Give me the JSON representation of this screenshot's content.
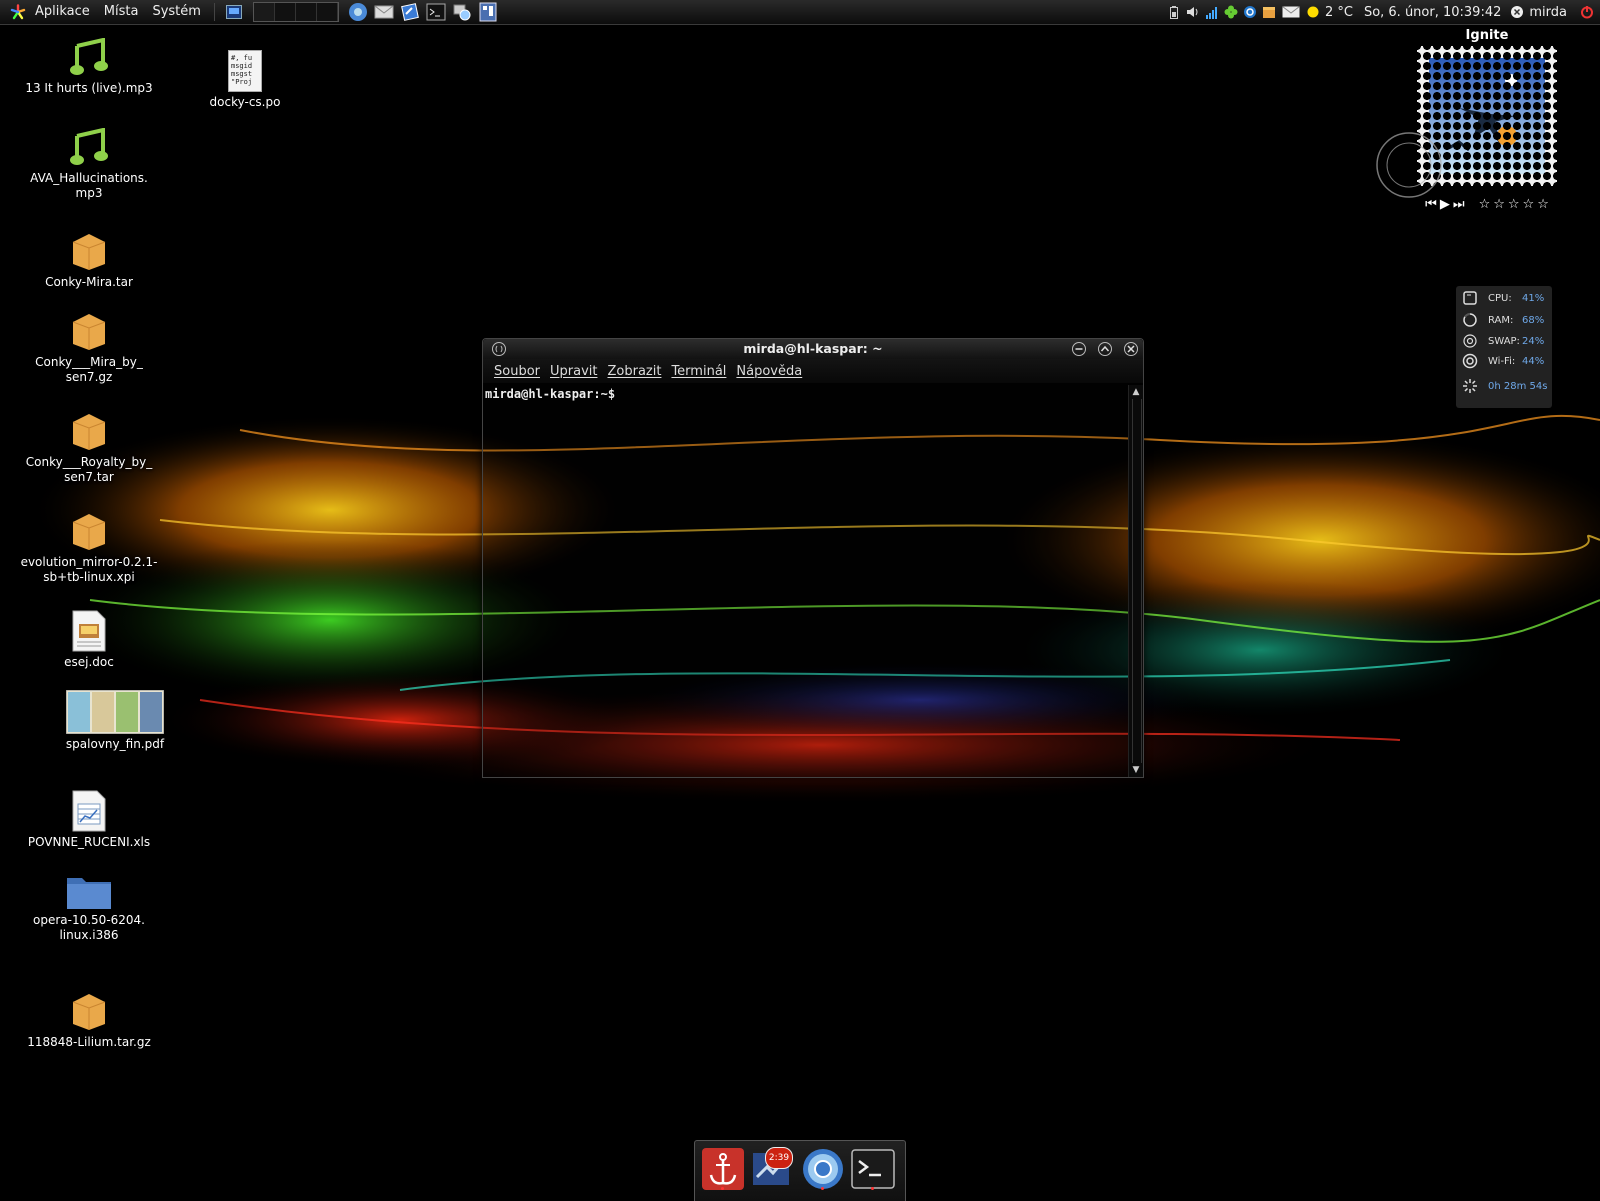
{
  "top_panel": {
    "menus": [
      "Aplikace",
      "Místa",
      "Systém"
    ],
    "weather": "2 °C",
    "clock": "So, 6. únor, 10:39:42",
    "user": "mirda",
    "launcher_icons": [
      "chromium-icon",
      "mail-icon",
      "feed-icon",
      "terminal-icon",
      "network-icon",
      "screenshot-icon"
    ],
    "tray_icons": [
      "battery-icon",
      "volume-icon",
      "signal-icon",
      "clover-icon",
      "sync-icon",
      "package-icon",
      "mail-icon",
      "sun-icon",
      "user-x-icon",
      "power-icon"
    ]
  },
  "desktop": {
    "icons": [
      {
        "label": "13 It hurts (live).mp3",
        "type": "audio"
      },
      {
        "label": "AVA_Hallucinations.\nmp3",
        "type": "audio"
      },
      {
        "label": "Conky-Mira.tar",
        "type": "archive"
      },
      {
        "label": "Conky___Mira_by_\nsen7.gz",
        "type": "archive"
      },
      {
        "label": "Conky___Royalty_by_\nsen7.tar",
        "type": "archive"
      },
      {
        "label": "evolution_mirror-0.2.1-\nsb+tb-linux.xpi",
        "type": "archive"
      },
      {
        "label": "esej.doc",
        "type": "document"
      },
      {
        "label": "spalovny_fin.pdf",
        "type": "pdf"
      },
      {
        "label": "POVNNE_RUCENI.xls",
        "type": "spreadsheet"
      },
      {
        "label": "opera-10.50-6204.\nlinux.i386",
        "type": "folder"
      },
      {
        "label": "118848-Lilium.tar.gz",
        "type": "archive"
      },
      {
        "label": "docky-cs.po",
        "type": "text"
      }
    ],
    "po_preview": [
      "#, fu",
      "msgid",
      "msgst",
      "\"Proj"
    ]
  },
  "terminal": {
    "title": "mirda@hl-kaspar: ~",
    "menu": [
      "Soubor",
      "Upravit",
      "Zobrazit",
      "Terminál",
      "Nápověda"
    ],
    "prompt": "mirda@hl-kaspar:~$"
  },
  "music": {
    "title": "Ignite",
    "controls": [
      "⏮",
      "▶",
      "⏭"
    ],
    "rating": 0,
    "stars_max": 5
  },
  "sysmon": {
    "rows": [
      {
        "label": "CPU:",
        "value": "41%"
      },
      {
        "label": "RAM:",
        "value": "68%"
      },
      {
        "label": "SWAP:",
        "value": "24%"
      },
      {
        "label": "Wi-Fi:",
        "value": "44%"
      }
    ],
    "uptime": "0h 28m 54s"
  },
  "dock": {
    "items": [
      "anchor-icon",
      "weather-app-icon",
      "chromium-icon",
      "terminal-icon"
    ],
    "badge": "2:39"
  },
  "colors": {
    "accent_blue": "#6fa8e8",
    "panel_bg": "#141414"
  }
}
